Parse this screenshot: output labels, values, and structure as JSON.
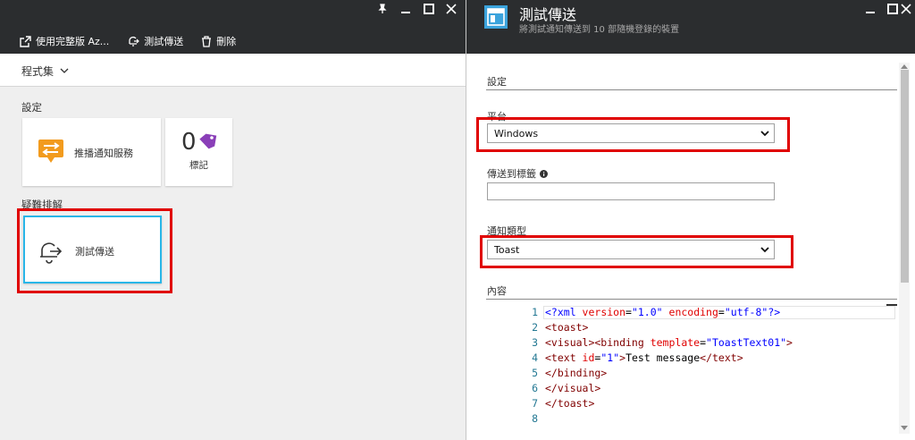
{
  "left_blade": {
    "toolbar": {
      "open_full": "使用完整版 Az...",
      "test_send": "測試傳送",
      "delete": "刪除"
    },
    "program_set": "程式集",
    "settings_title": "設定",
    "push_service_label": "推播通知服務",
    "tags_count": "0",
    "tags_label": "標記",
    "troubleshoot_title": "疑難排解",
    "test_send_tile_label": "測試傳送"
  },
  "right_blade": {
    "title": "測試傳送",
    "subtitle": "將測試通知傳送到 10 部隨機登錄的裝置",
    "settings_title": "設定",
    "platform_label": "平台",
    "platform_value": "Windows",
    "send_to_tag_label": "傳送到標籤",
    "send_to_tag_value": "",
    "notification_type_label": "通知類型",
    "notification_type_value": "Toast",
    "content_label": "內容",
    "code_lines": [
      {
        "n": "1"
      },
      {
        "n": "2"
      },
      {
        "n": "3"
      },
      {
        "n": "4"
      },
      {
        "n": "5"
      },
      {
        "n": "6"
      },
      {
        "n": "7"
      },
      {
        "n": "8"
      }
    ],
    "code": {
      "l1_a": "<?xml ",
      "l1_b": "version",
      "l1_c": "=",
      "l1_d": "\"1.0\"",
      "l1_e": " ",
      "l1_f": "encoding",
      "l1_g": "=",
      "l1_h": "\"utf-8\"",
      "l1_i": "?>",
      "l2": "<toast>",
      "l3_a": "<visual><binding ",
      "l3_b": "template",
      "l3_c": "=",
      "l3_d": "\"ToastText01\"",
      "l3_e": ">",
      "l4_a": "<text ",
      "l4_b": "id",
      "l4_c": "=",
      "l4_d": "\"1\"",
      "l4_e": ">",
      "l4_f": "Test message",
      "l4_g": "</text>",
      "l5": "</binding>",
      "l6": "</visual>",
      "l7": "</toast>",
      "l8": ""
    }
  },
  "colors": {
    "header_bg": "#2b2d2f",
    "highlight_red": "#e00000",
    "selected_tile_border": "#29b6e8",
    "accent_orange": "#f29b1e",
    "tag_purple": "#8a3fb8",
    "blade_icon_blue": "#3ba3dc"
  }
}
